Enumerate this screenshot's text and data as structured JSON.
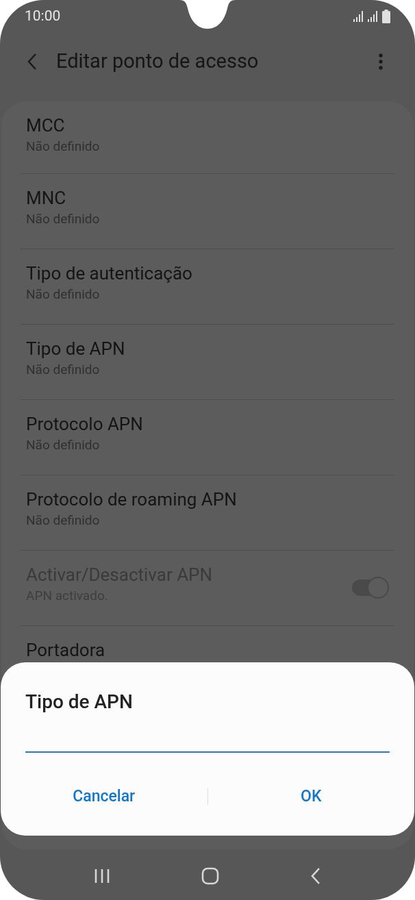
{
  "status_bar": {
    "time": "10:00"
  },
  "header": {
    "title": "Editar ponto de acesso"
  },
  "settings": [
    {
      "kind": "text",
      "title": "MCC",
      "subtitle": "Não definido"
    },
    {
      "kind": "text",
      "title": "MNC",
      "subtitle": "Não definido"
    },
    {
      "kind": "text",
      "title": "Tipo de autenticação",
      "subtitle": "Não definido"
    },
    {
      "kind": "text",
      "title": "Tipo de APN",
      "subtitle": "Não definido"
    },
    {
      "kind": "text",
      "title": "Protocolo APN",
      "subtitle": "Não definido"
    },
    {
      "kind": "text",
      "title": "Protocolo de roaming APN",
      "subtitle": "Não definido"
    },
    {
      "kind": "toggle",
      "title": "Activar/Desactivar APN",
      "subtitle": "APN activado.",
      "on": true,
      "disabled": true
    },
    {
      "kind": "text",
      "title": "Portadora"
    }
  ],
  "dialog": {
    "title": "Tipo de APN",
    "buttons": [
      "Cancelar",
      "OK"
    ]
  }
}
